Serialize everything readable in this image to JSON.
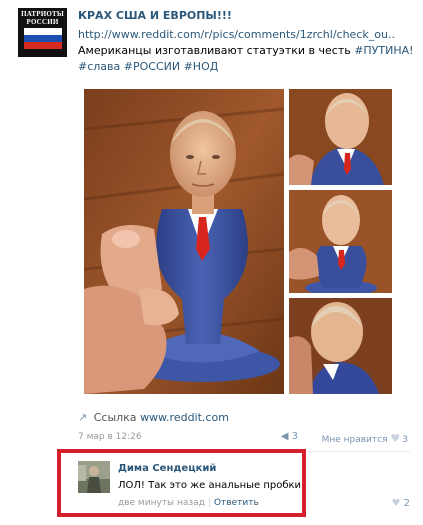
{
  "post": {
    "author_avatar_text": "ПАТРИОТЫ РОССИИ",
    "title": "КРАХ США И ЕВРОПЫ!!!",
    "link_url": "http://www.reddit.com/r/pics/comments/1zrchl/check_ou..",
    "text_prefix": "Американцы изготавливают статуэтки в честь ",
    "text_hashtag": "#ПУТИНА!",
    "hashtags": "#слава #РОССИИ #НОД",
    "link_label": "Ссылка",
    "link_domain": "www.reddit.com",
    "date": "7 мар в 12:26",
    "reposts": "3",
    "likes_label": "Мне нравится",
    "likes_count": "3"
  },
  "comment": {
    "author": "Дима Сендецкий",
    "text": "ЛОЛ! Так это же анальные пробки!",
    "time": "две минуты назад",
    "reply_label": "Ответить",
    "likes_count": "2"
  },
  "colors": {
    "link_blue": "#2b587a",
    "highlight_red": "#d3202c",
    "flag_white": "#ffffff",
    "flag_blue": "#1c4fb0",
    "flag_red": "#d52b1e"
  },
  "icons": {
    "link": "link-arrow-icon",
    "repost": "megaphone-icon",
    "like": "heart-icon"
  }
}
